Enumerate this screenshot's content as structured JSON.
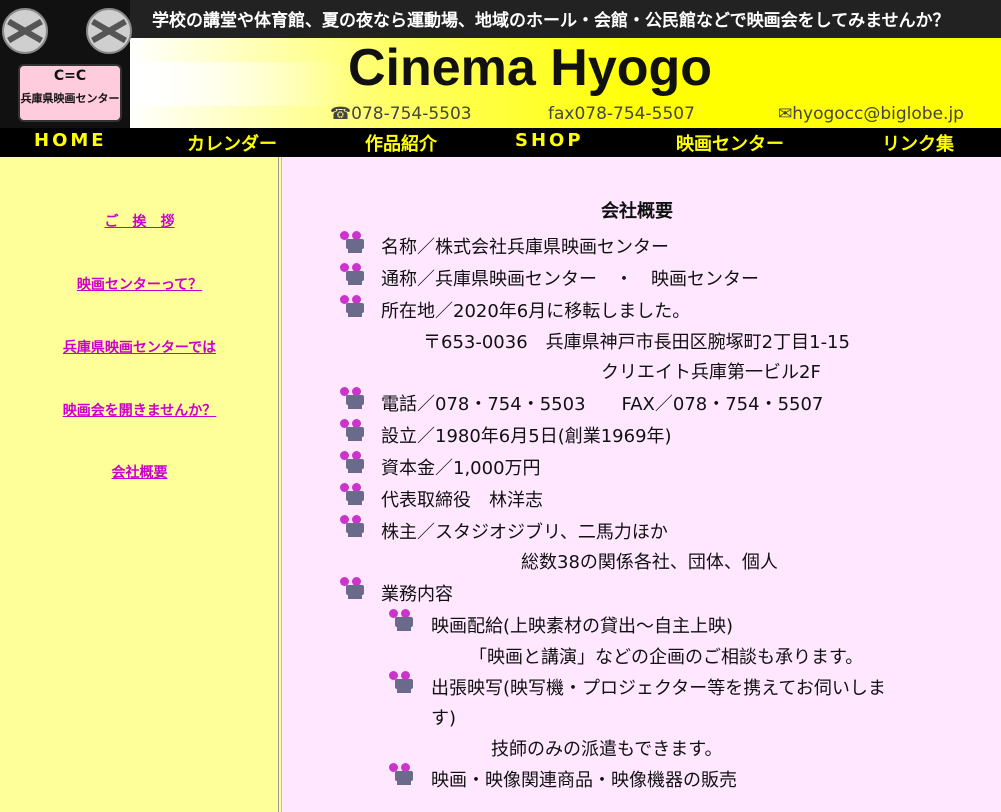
{
  "header": {
    "tagline": "学校の講堂や体育館、夏の夜なら運動場、地域のホール・会館・公民館などで映画会をしてみませんか？",
    "title": "Cinema Hyogo",
    "logo_glyph": "C=C",
    "logo_text": "兵庫県映画センター",
    "tel": "☎078-754-5503",
    "fax": "fax078-754-5507",
    "email": "✉hyogocc@biglobe.jp"
  },
  "nav": {
    "home": "HOME",
    "calendar": "カレンダー",
    "works": "作品紹介",
    "shop": "SHOP",
    "center": "映画センター",
    "links": "リンク集"
  },
  "sidebar": {
    "items": [
      {
        "label": "ご　挨　拶"
      },
      {
        "label": "映画センターって？"
      },
      {
        "label": "兵庫県映画センターでは"
      },
      {
        "label": "映画会を開きませんか？"
      },
      {
        "label": "会社概要"
      }
    ]
  },
  "main": {
    "title": "会社概要",
    "name": "名称／株式会社兵庫県映画センター",
    "alias": "通称／兵庫県映画センター　・　映画センター",
    "location": "所在地／2020年6月に移転しました。",
    "address1": "〒653-0036　兵庫県神戸市長田区腕塚町2丁目1-15",
    "address2": "クリエイト兵庫第一ビル2F",
    "phone": "電話／078・754・5503　　FAX／078・754・5507",
    "founded": "設立／1980年6月5日(創業1969年)",
    "capital": "資本金／1,000万円",
    "ceo": "代表取締役　林洋志",
    "shareholders": "株主／スタジオジブリ、二馬力ほか",
    "shareholders_total": "総数38の関係各社、団体、個人",
    "business": "業務内容",
    "biz1": "映画配給(上映素材の貸出～自主上映)",
    "biz1_note": "「映画と講演」などの企画のご相談も承ります。",
    "biz2_line1": "出張映写(映写機・プロジェクター等を携えてお伺いしま",
    "biz2_line2": "す)",
    "biz2_note": "技師のみの派遣もできます。",
    "biz3": "映画・映像関連商品・映像機器の販売"
  }
}
